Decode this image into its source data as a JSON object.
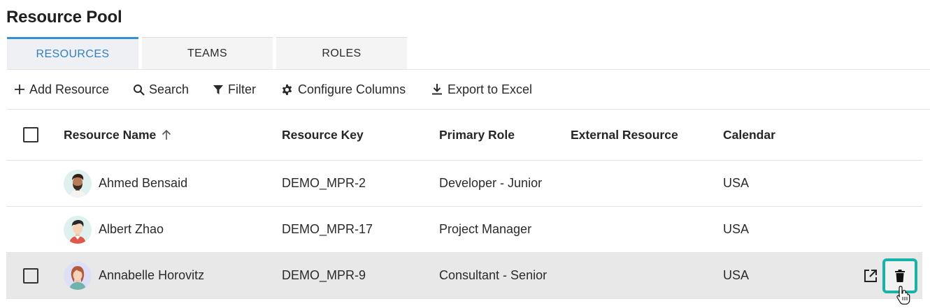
{
  "page": {
    "title": "Resource Pool"
  },
  "tabs": [
    {
      "label": "RESOURCES",
      "active": true
    },
    {
      "label": "TEAMS",
      "active": false
    },
    {
      "label": "ROLES",
      "active": false
    }
  ],
  "toolbar": {
    "add_resource": "Add Resource",
    "search": "Search",
    "filter": "Filter",
    "configure_columns": "Configure Columns",
    "export_to_excel": "Export to Excel"
  },
  "table": {
    "columns": {
      "resource_name": "Resource Name",
      "resource_key": "Resource Key",
      "primary_role": "Primary Role",
      "external_resource": "External Resource",
      "calendar": "Calendar"
    },
    "sort_icon": "arrow-up-icon",
    "rows": [
      {
        "name": "Ahmed Bensaid",
        "key": "DEMO_MPR-2",
        "role": "Developer - Junior",
        "external": "",
        "calendar": "USA",
        "avatar": "man-beard-avatar"
      },
      {
        "name": "Albert Zhao",
        "key": "DEMO_MPR-17",
        "role": "Project Manager",
        "external": "",
        "calendar": "USA",
        "avatar": "man-avatar"
      },
      {
        "name": "Annabelle Horovitz",
        "key": "DEMO_MPR-9",
        "role": "Consultant - Senior",
        "external": "",
        "calendar": "USA",
        "avatar": "woman-avatar"
      }
    ]
  },
  "colors": {
    "accent": "#3a8fd1",
    "highlight": "#18b3a8",
    "row_hover": "#e8e8e8"
  }
}
